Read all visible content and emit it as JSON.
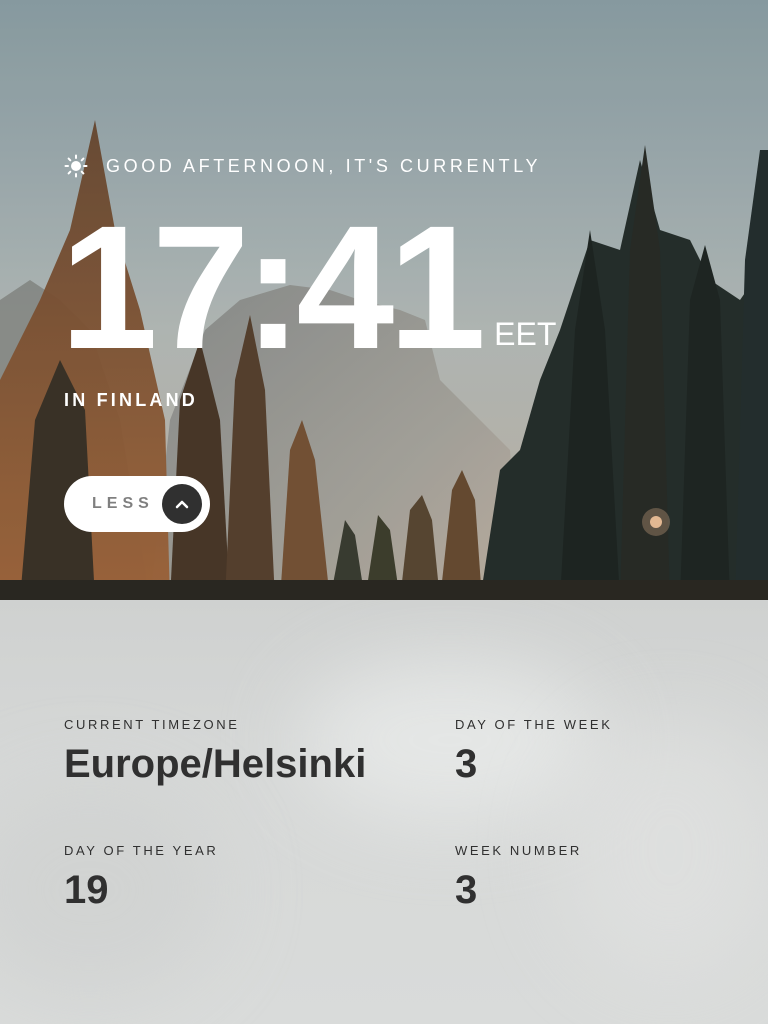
{
  "greeting": {
    "icon": "sun-icon",
    "text": "Good afternoon, it's currently"
  },
  "clock": {
    "time": "17:41",
    "timezone_abbreviation": "EET"
  },
  "location": {
    "text": "In Finland"
  },
  "toggle": {
    "label": "Less",
    "icon": "chevron-up-icon"
  },
  "details": {
    "current_timezone": {
      "label": "Current Timezone",
      "value": "Europe/Helsinki"
    },
    "day_of_week": {
      "label": "Day of the week",
      "value": "3"
    },
    "day_of_year": {
      "label": "Day of the year",
      "value": "19"
    },
    "week_number": {
      "label": "Week number",
      "value": "3"
    }
  },
  "colors": {
    "text_light": "#ffffff",
    "text_dark": "#303030",
    "button_bg": "#ffffff",
    "button_icon_bg": "#303030",
    "panel_bg": "#d6d8d7"
  }
}
